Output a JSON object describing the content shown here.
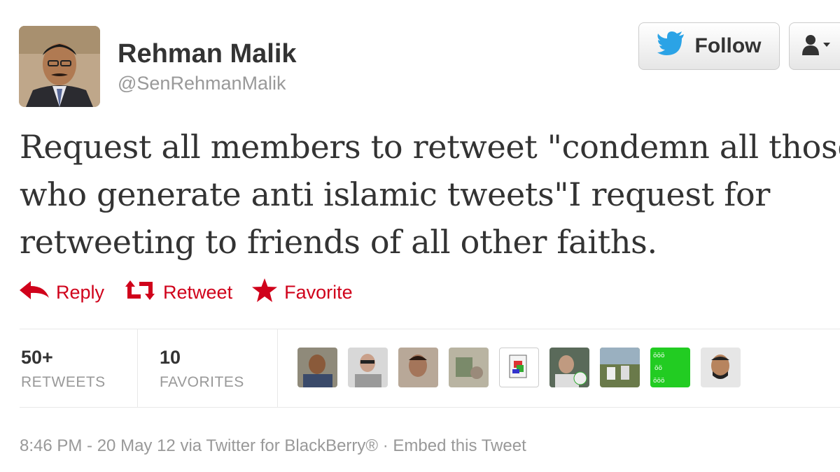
{
  "user": {
    "display_name": "Rehman Malik",
    "screen_name": "@SenRehmanMalik"
  },
  "buttons": {
    "follow_label": "Follow"
  },
  "tweet": {
    "text_line1": "Request all members to retweet \"condemn all those",
    "text_line2": "who generate anti islamic tweets\"I request for",
    "text_line3": "retweeting to friends of all other faiths."
  },
  "actions": {
    "reply": "Reply",
    "retweet": "Retweet",
    "favorite": "Favorite"
  },
  "stats": {
    "retweets_count": "50+",
    "retweets_label": "RETWEETS",
    "favorites_count": "10",
    "favorites_label": "FAVORITES"
  },
  "footer": {
    "timestamp": "8:46 PM - 20 May 12 via Twitter for BlackBerry®",
    "separator": " · ",
    "embed": "Embed this Tweet"
  },
  "colors": {
    "action_red": "#d0021b",
    "twitter_blue": "#2ba3e6",
    "muted_text": "#999999"
  },
  "icons": [
    "twitter-bird-icon",
    "user-dropdown-icon",
    "reply-icon",
    "retweet-icon",
    "favorite-star-icon"
  ]
}
